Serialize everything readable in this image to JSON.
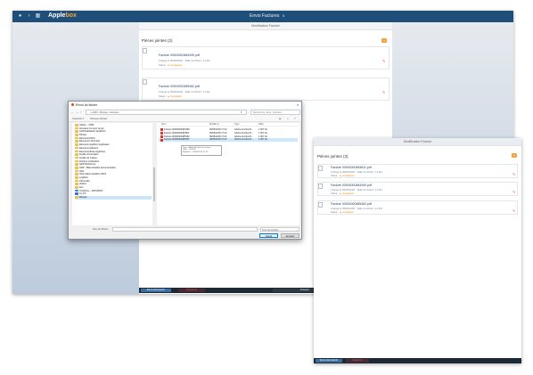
{
  "app": {
    "brand_main": "Apple",
    "brand_accent": "box",
    "title": "Envoi Factures",
    "title_chevron": "∨",
    "subheader": "Modification Facture",
    "colors": {
      "topbar": "#1f4f78",
      "accent": "#f5a142",
      "bottom": "#1d2a36",
      "alert": "#e05a65"
    },
    "pieces_title": "Pièces jointes (2)",
    "add_symbol": "+",
    "files": [
      {
        "name": "Facture 00004000484490.pdf",
        "meta": "Chargé le 09/06/2018 · Taille du fichier: 1,4 Mo",
        "state_prefix": "Statut :",
        "state_text": "A analyser"
      },
      {
        "name": "Facture 00004000485462.pdf",
        "meta": "Chargé le 09/06/2018 · Taille du fichier: 1,4 Mo",
        "state_prefix": "Statut :",
        "state_text": "A analyser"
      }
    ],
    "bottom_buttons": {
      "left": "Envoi documents",
      "mid": "Supprimer",
      "right": "Envoyer"
    }
  },
  "dialog": {
    "title": "Envoi du fichier",
    "breadcrumb": [
      "UniPC",
      "Bureau",
      "Factures"
    ],
    "search_placeholder": "Rechercher dans : Factures",
    "organize": "Organiser ▾",
    "new_folder": "Nouveau dossier",
    "tree": [
      {
        "label": "Adobe – CRM",
        "type": "folder"
      },
      {
        "label": "Annuaire Ce tenir rempl",
        "type": "folder"
      },
      {
        "label": "Cdd Réalisation Appliform",
        "type": "folder"
      },
      {
        "label": "Direlon",
        "type": "folder"
      },
      {
        "label": "Elements PDIA",
        "type": "folder"
      },
      {
        "label": "Elements Informatis",
        "type": "folder"
      },
      {
        "label": "Elements Applibon Appliware",
        "type": "folder"
      },
      {
        "label": "Elements Maisons",
        "type": "folder"
      },
      {
        "label": "Elements Base Applicbox",
        "type": "folder"
      },
      {
        "label": "Feuille d'inventaire",
        "type": "folder"
      },
      {
        "label": "Feuille de Caisse",
        "type": "folder"
      },
      {
        "label": "Fichiers notification",
        "type": "folder"
      },
      {
        "label": "GDP Référence",
        "type": "folder"
      },
      {
        "label": "GDP - Base Réalisé documentation",
        "type": "folder"
      },
      {
        "label": "GDJ",
        "type": "folder"
      },
      {
        "label": "Information Applibox 2019",
        "type": "folder"
      },
      {
        "label": "Logibois",
        "type": "folder"
      },
      {
        "label": "Pétronelle",
        "type": "folder"
      },
      {
        "label": "Vidéos",
        "type": "folder"
      },
      {
        "label": "Zen",
        "type": "folder"
      },
      {
        "label": "OneDrive – APPLIBOX",
        "type": "cloud"
      },
      {
        "label": "Ce PC",
        "type": "pc"
      },
      {
        "label": "Bureau",
        "type": "folder"
      }
    ],
    "columns": [
      "Nom",
      "Modifié le",
      "Type",
      "Taille"
    ],
    "rows": [
      {
        "name": "Facture 00004000484490",
        "date": "09/06/2018 17:22",
        "type": "Adobe Acrobat D...",
        "size": "1 907 Ko"
      },
      {
        "name": "Facture 00004000484811",
        "date": "09/06/2018 17:22",
        "type": "Adobe Acrobat D...",
        "size": "1 907 Ko"
      },
      {
        "name": "Facture 00004000485462",
        "date": "09/06/2018 17:22",
        "type": "Adobe Acrobat D...",
        "size": "1 907 Ko"
      },
      {
        "name": "Facture 00004000485467",
        "date": "09/06/2018 17:22",
        "type": "Adobe Acrobat D...",
        "size": "1 907 Ko"
      }
    ],
    "tooltip": [
      "Type : Adobe Acrobat Document",
      "Taille : 1,86 Mo",
      "Modifié le : 09/06/2018 17:22"
    ],
    "filename_label": "Nom du fichier :",
    "filetype": "Tous les fichiers",
    "open_label": "Ouvrir",
    "cancel_label": "Annuler"
  },
  "app2": {
    "subheader": "Modification Facture",
    "pieces_title": "Pièces jointes (3)",
    "add_symbol": "+",
    "files": [
      {
        "name": "Facture 00004000484811.pdf",
        "meta": "Chargé le 09/06/2018 · Taille du fichier: 1,4 Mo",
        "state_prefix": "Statut :",
        "state_text": "A analyser"
      },
      {
        "name": "Facture 00004000484490.pdf",
        "meta": "Chargé le 09/06/2018 · Taille du fichier: 1,4 Mo",
        "state_prefix": "Statut :",
        "state_text": "A analyser"
      },
      {
        "name": "Facture 00004000485462.pdf",
        "meta": "Chargé le 09/06/2018 · Taille du fichier: 1,4 Mo",
        "state_prefix": "Statut :",
        "state_text": "A analyser"
      }
    ],
    "bottom_buttons": {
      "left": "Envoi documents",
      "mid": "Supprimer"
    }
  }
}
